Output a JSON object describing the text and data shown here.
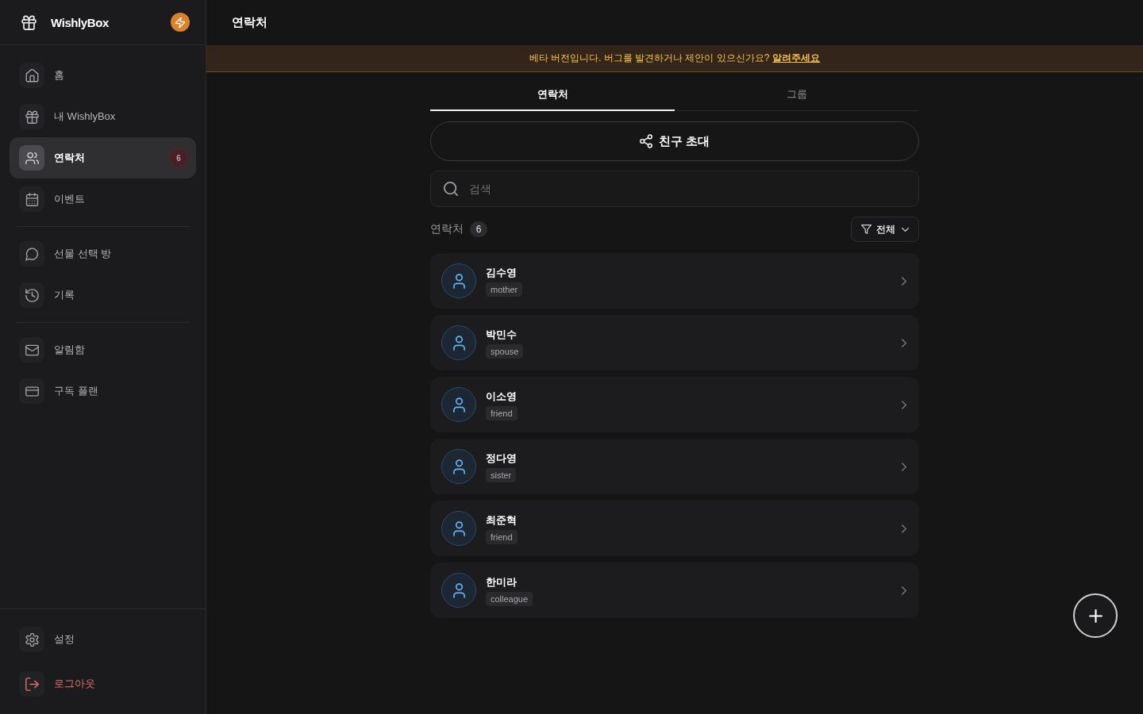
{
  "sidebar": {
    "brand": "WishlyBox",
    "sections": [
      {
        "items": [
          {
            "label": "홈",
            "selected": false
          },
          {
            "label": "내 WishlyBox",
            "selected": false
          },
          {
            "label": "연락처",
            "selected": true,
            "badge": "6"
          },
          {
            "label": "이벤트",
            "selected": false
          }
        ]
      },
      {
        "items": [
          {
            "label": "선물 선택 방",
            "selected": false
          },
          {
            "label": "기록",
            "selected": false
          }
        ]
      },
      {
        "items": [
          {
            "label": "알림함",
            "selected": false
          },
          {
            "label": "구독 플랜",
            "selected": false
          }
        ]
      }
    ],
    "footer_items": [
      {
        "label": "설정",
        "kind": "default"
      },
      {
        "label": "로그아웃",
        "kind": "danger"
      }
    ]
  },
  "header": {
    "title": "연락처"
  },
  "banner": {
    "text": "베타 버전입니다. 버그를 발견하거나 제안이 있으신가요?",
    "link": "알려주세요"
  },
  "tabs": [
    {
      "label": "연락처",
      "selected": true
    },
    {
      "label": "그룹",
      "selected": false
    }
  ],
  "invite_button": {
    "label": "친구 초대"
  },
  "search": {
    "placeholder": "검색"
  },
  "list_header": {
    "label": "연락처",
    "count": "6"
  },
  "filter": {
    "label": "전체"
  },
  "contacts": [
    {
      "name": "김수영",
      "relation": "mother"
    },
    {
      "name": "박민수",
      "relation": "spouse"
    },
    {
      "name": "이소영",
      "relation": "friend"
    },
    {
      "name": "정다영",
      "relation": "sister"
    },
    {
      "name": "최준혁",
      "relation": "friend"
    },
    {
      "name": "한미라",
      "relation": "colleague"
    }
  ]
}
